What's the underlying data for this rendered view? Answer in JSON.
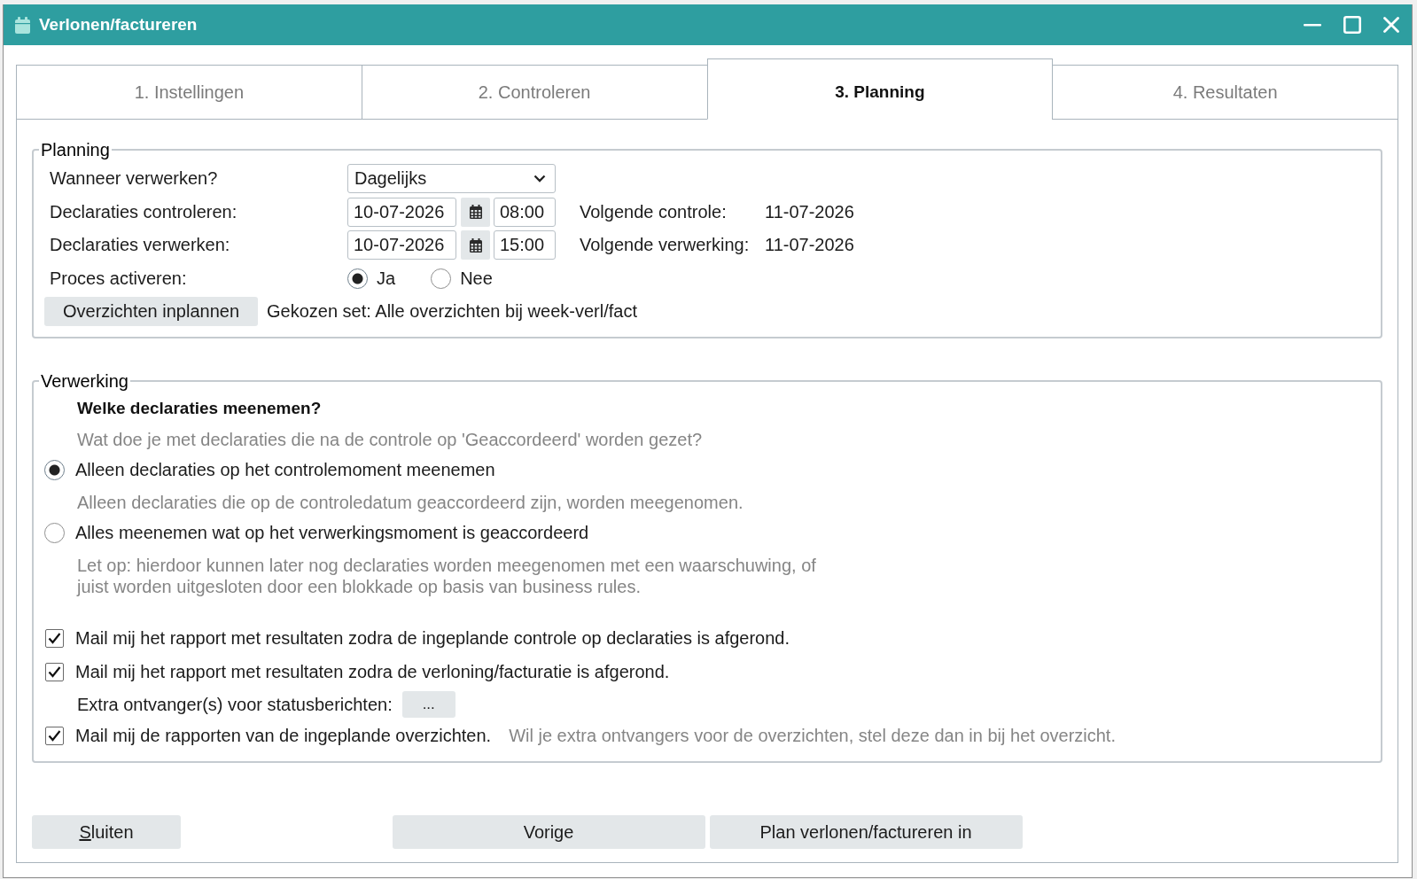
{
  "window": {
    "title": "Verlonen/factureren"
  },
  "tabs": [
    {
      "label": "1. Instellingen",
      "selected": false
    },
    {
      "label": "2. Controleren",
      "selected": false
    },
    {
      "label": "3. Planning",
      "selected": true
    },
    {
      "label": "4. Resultaten",
      "selected": false
    }
  ],
  "planning": {
    "title": "Planning",
    "frequency": {
      "label": "Wanneer verwerken?",
      "value": "Dagelijks"
    },
    "schedules": [
      {
        "label": "Declaraties controleren:",
        "date": "10-07-2026",
        "time": "08:00",
        "next_label": "Volgende controle:",
        "next_date": "11-07-2026"
      },
      {
        "label": "Declaraties verwerken:",
        "date": "10-07-2026",
        "time": "15:00",
        "next_label": "Volgende verwerking:",
        "next_date": "11-07-2026"
      }
    ],
    "activate": {
      "label": "Proces activeren:",
      "options": [
        {
          "label": "Ja",
          "selected": true
        },
        {
          "label": "Nee",
          "selected": false
        }
      ]
    },
    "overviews_button": "Overzichten inplannen",
    "chosen_set": "Gekozen set: Alle overzichten bij week-verl/fact"
  },
  "processing": {
    "title": "Verwerking",
    "question": "Welke declaraties meenemen?",
    "question_hint": "Wat doe je met declaraties die na de controle op 'Geaccordeerd' worden gezet?",
    "options": [
      {
        "label": "Alleen declaraties op het controlemoment meenemen",
        "selected": true,
        "description": "Alleen declaraties die op de controledatum geaccordeerd zijn, worden meegenomen."
      },
      {
        "label": "Alles meenemen wat op het verwerkingsmoment is geaccordeerd",
        "selected": false,
        "description": "Let op: hierdoor kunnen later nog declaraties worden meegenomen met een waarschuwing, of\njuist worden uitgesloten door een blokkade op basis van business rules."
      }
    ],
    "mail_options": [
      {
        "kind": "checkbox",
        "label": "Mail mij het rapport met resultaten zodra de ingeplande controle op declaraties is afgerond.",
        "checked": true
      },
      {
        "kind": "checkbox",
        "label": "Mail mij het rapport met resultaten zodra de verloning/facturatie is afgerond.",
        "checked": true
      },
      {
        "kind": "recipients",
        "label": "Extra ontvanger(s) voor statusberichten:",
        "button": "..."
      },
      {
        "kind": "checkbox",
        "label": "Mail mij de rapporten van de ingeplande overzichten.",
        "checked": true,
        "hint": "Wil je extra ontvangers voor de overzichten, stel deze dan in bij het overzicht."
      }
    ]
  },
  "footer": {
    "close_button": {
      "label": "Sluiten",
      "access_key_underlined": true
    },
    "nav_buttons": [
      "Vorige",
      "Plan verlonen/factureren in"
    ]
  }
}
